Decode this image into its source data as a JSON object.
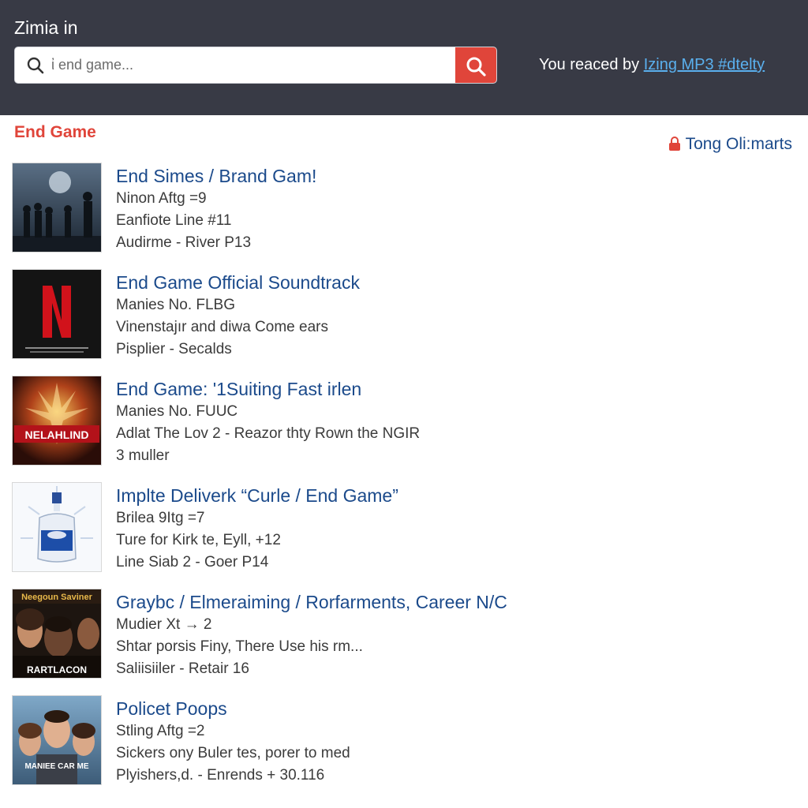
{
  "header": {
    "title": "Zimia in",
    "search": {
      "placeholder": "ἰ end game..."
    },
    "hint_text": "You reaced by",
    "hint_link": "Izing MP3 #dtelty"
  },
  "section": {
    "title": "End Game",
    "owner_label": "Tong Oli:marts"
  },
  "results": [
    {
      "title": "End Simes / Brand Gam!",
      "lines": [
        "Ninon Aftg =9",
        "Eanfiote Line #11",
        "Audirme   - River P13"
      ],
      "thumb": "night-battle-scene"
    },
    {
      "title": "End Game Official Soundtrack",
      "lines": [
        "Manies No. FLBG",
        "Vinenstajır and diwa Come ears",
        "Pisplier  - Secalds"
      ],
      "thumb": "red-n-logo"
    },
    {
      "title": "End Game: '1Suiting Fast irlen",
      "lines": [
        "Manies No. FUUC",
        "Adlat The Lov 2  - Reazor thty Rown the NGIR",
        "3 muller"
      ],
      "thumb": "fiery-poster",
      "thumb_text": "NELAHLIND"
    },
    {
      "title": "Implte Deliverk “Curle / End Game”",
      "lines": [
        "Brilea 9Itg =7",
        "Ture for Kirk te, Eyll, +12",
        "Line Siab 2   - Goer P14"
      ],
      "thumb": "perfume-bottle"
    },
    {
      "title": "Graybc / Elmeraiming / Rorfarments, Career N/C",
      "lines": [
        "Mudier Xt → 2",
        "Shtar porsis Finy, There Use his rm...",
        "Saliisiiler   - Retair 16"
      ],
      "thumb": "cast-poster",
      "thumb_top_text": "Neegoun Saviner",
      "thumb_bottom_text": "RARTLACON"
    },
    {
      "title": "Policet Poops",
      "lines": [
        "Stling Aftg =2",
        "Sickers ony Buler tes, porer to med",
        "Plyishers,d.  - Enrends + 30.116"
      ],
      "thumb": "people-poster",
      "thumb_text": "MANIEE CAR ME"
    }
  ],
  "colors": {
    "header_bg": "#383a45",
    "accent": "#e0453a",
    "link": "#1b4a8b",
    "hint_link": "#5ab0ee"
  }
}
